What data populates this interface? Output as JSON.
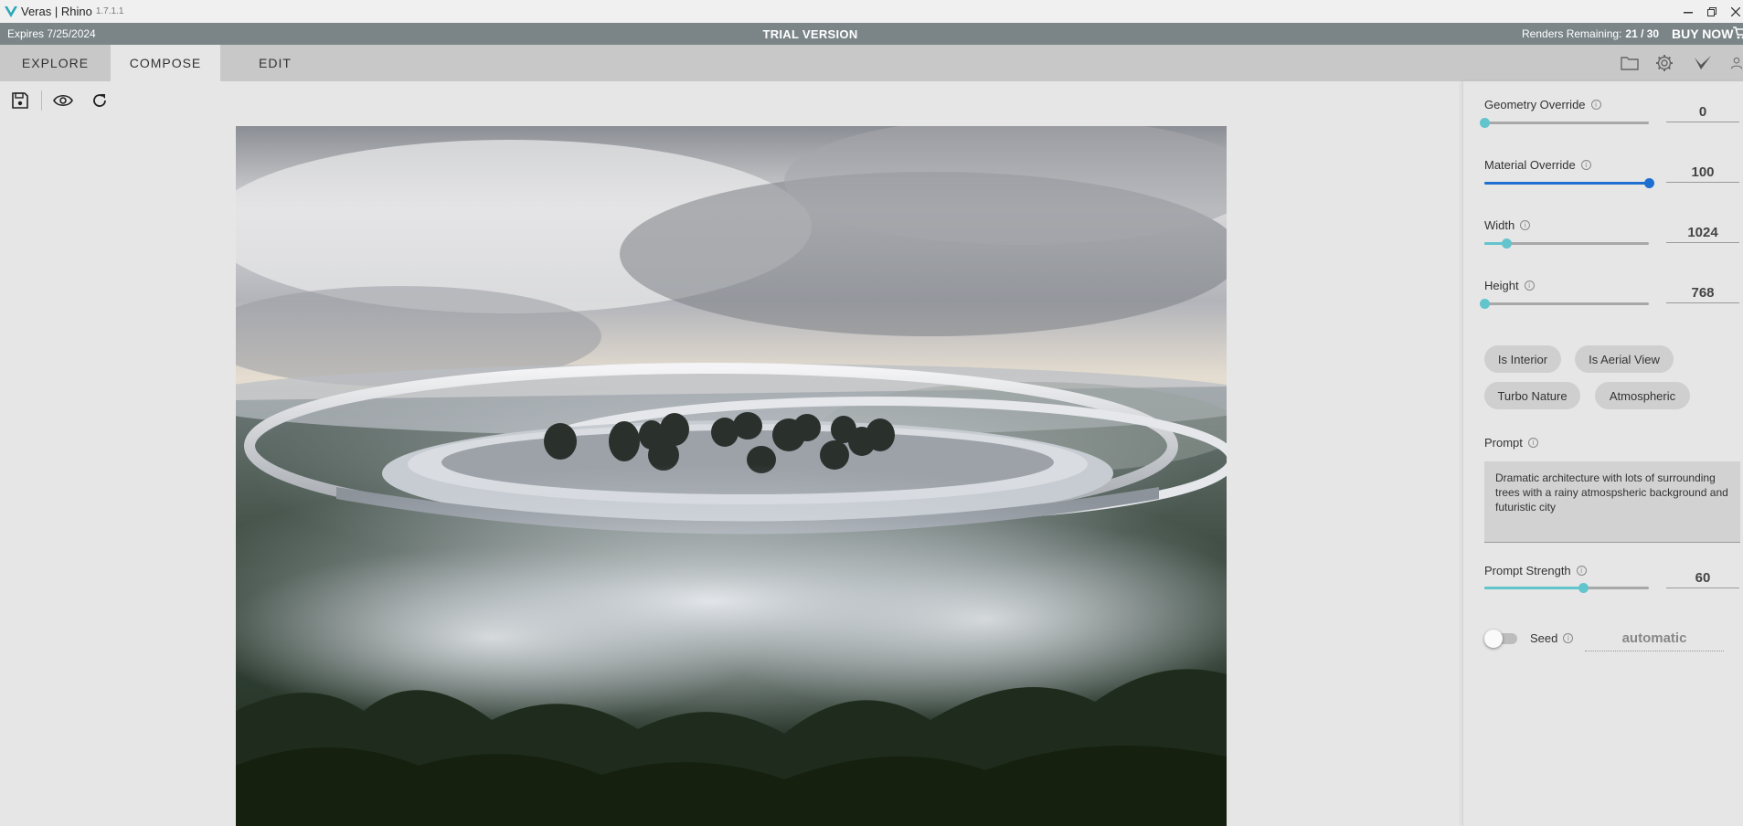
{
  "window": {
    "app_title": "Veras | Rhino",
    "version": "1.7.1.1"
  },
  "banner": {
    "expires": "Expires 7/25/2024",
    "trial": "TRIAL VERSION",
    "renders_label": "Renders Remaining:",
    "renders_value": "21 / 30",
    "buy_now": "BUY NOW"
  },
  "tabs": [
    {
      "label": "EXPLORE"
    },
    {
      "label": "COMPOSE"
    },
    {
      "label": "EDIT"
    }
  ],
  "active_tab": "COMPOSE",
  "toolbar_icons": [
    "save-icon",
    "eye-icon",
    "refresh-icon"
  ],
  "tab_icons": [
    "folder-icon",
    "gear-icon",
    "checkmark-icon",
    "user-icon"
  ],
  "panel": {
    "geometry_override": {
      "label": "Geometry Override",
      "value": "0",
      "level": 0.0
    },
    "material_override": {
      "label": "Material Override",
      "value": "100",
      "level": 1.0
    },
    "width": {
      "label": "Width",
      "value": "1024",
      "level": 0.13
    },
    "height": {
      "label": "Height",
      "value": "768",
      "level": 0.0
    },
    "chips": [
      {
        "label": "Is Interior"
      },
      {
        "label": "Is Aerial View"
      },
      {
        "label": "Turbo Nature"
      },
      {
        "label": "Atmospheric"
      }
    ],
    "prompt": {
      "label": "Prompt",
      "text": "Dramatic architecture with lots of surrounding trees with a rainy atmospsheric background and futuristic city"
    },
    "prompt_strength": {
      "label": "Prompt Strength",
      "value": "60",
      "level": 0.6
    },
    "seed": {
      "label": "Seed",
      "value": "automatic",
      "enabled": false
    }
  },
  "colors": {
    "accent_teal": "#62c4cc",
    "accent_blue": "#1e6fd0",
    "banner": "#7b8588",
    "logo_teal": "#2aa8b8"
  }
}
